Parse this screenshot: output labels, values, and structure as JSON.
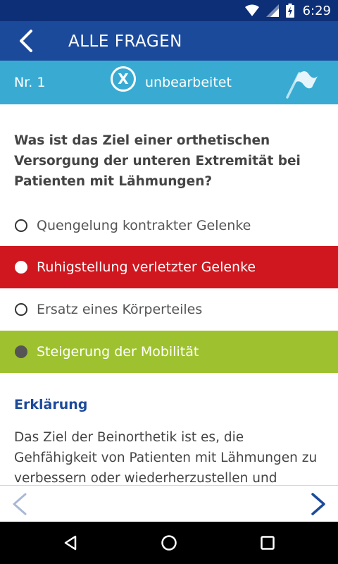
{
  "statusbar": {
    "time": "6:29"
  },
  "appbar": {
    "title": "ALLE FRAGEN"
  },
  "question_bar": {
    "number": "Nr. 1",
    "status_icon_letter": "X",
    "status": "unbearbeitet"
  },
  "question": {
    "text": "Was ist das Ziel einer orthetischen Versorgung der unteren Extremität bei Patienten mit Lähmungen?"
  },
  "answers": [
    {
      "label": "Quengelung kontrakter Gelenke",
      "state": "neutral"
    },
    {
      "label": "Ruhigstellung verletzter Gelenke",
      "state": "wrong"
    },
    {
      "label": "Ersatz eines Körperteiles",
      "state": "neutral"
    },
    {
      "label": "Steigerung der Mobilität",
      "state": "correct"
    }
  ],
  "explanation": {
    "title": "Erklärung",
    "text": "Das Ziel der Beinorthetik ist es, die Gehfähigkeit von Patienten mit Lähmungen zu verbessern oder wiederherzustellen und"
  },
  "colors": {
    "statusbar": "#0d2f78",
    "appbar": "#1c4a9b",
    "question_bar": "#39abd2",
    "wrong": "#d0161e",
    "correct": "#9ec22f",
    "accent_text": "#1c4a9b"
  },
  "icons": {
    "back": "arrow-left-icon",
    "flag": "flag-icon",
    "prev": "chevron-left-icon",
    "next": "chevron-right-icon"
  }
}
